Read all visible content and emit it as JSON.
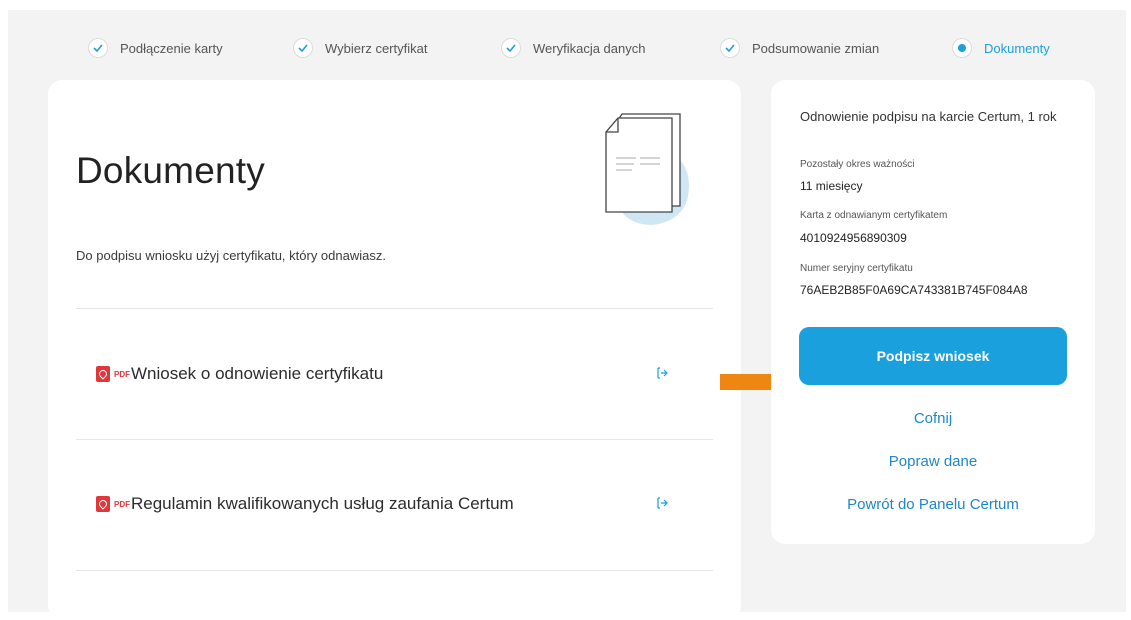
{
  "stepper": {
    "steps": [
      {
        "label": "Podłączenie karty",
        "state": "done"
      },
      {
        "label": "Wybierz certyfikat",
        "state": "done"
      },
      {
        "label": "Weryfikacja danych",
        "state": "done"
      },
      {
        "label": "Podsumowanie zmian",
        "state": "done"
      },
      {
        "label": "Dokumenty",
        "state": "active"
      }
    ]
  },
  "main": {
    "title": "Dokumenty",
    "description": "Do podpisu wniosku użyj certyfikatu, który odnawiasz.",
    "pdf_tag": "PDF",
    "documents": [
      {
        "name": "Wniosek o odnowienie certyfikatu"
      },
      {
        "name": "Regulamin kwalifikowanych usług zaufania Certum"
      }
    ]
  },
  "summary": {
    "title": "Odnowienie podpisu na karcie Certum, 1 rok",
    "validity_label": "Pozostały okres ważności",
    "validity_value": "11 miesięcy",
    "card_label": "Karta z odnawianym certyfikatem",
    "card_value": "4010924956890309",
    "serial_label": "Numer seryjny certyfikatu",
    "serial_value": "76AEB2B85F0A69CA743381B745F084A8",
    "sign_button": "Podpisz wniosek",
    "back_link": "Cofnij",
    "fix_link": "Popraw dane",
    "panel_link": "Powrót do Panelu Certum"
  },
  "colors": {
    "accent": "#1aa0dc",
    "link": "#1e87c9",
    "arrow": "#ee8712",
    "pdf": "#e0373b"
  },
  "icons": [
    "check-icon",
    "active-step-icon",
    "document-illustration",
    "pdf-icon",
    "external-link-icon",
    "arrow-icon"
  ]
}
